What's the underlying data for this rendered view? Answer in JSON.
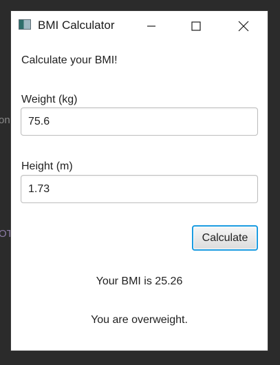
{
  "background": {
    "fragment_1": "on",
    "fragment_2": "OT"
  },
  "window": {
    "title": "BMI Calculator",
    "icon": "app-window-icon",
    "controls": {
      "minimize": "minimize-icon",
      "maximize": "maximize-icon",
      "close": "close-icon"
    }
  },
  "form": {
    "prompt": "Calculate your BMI!",
    "weight": {
      "label": "Weight (kg)",
      "value": "75.6"
    },
    "height": {
      "label": "Height (m)",
      "value": "1.73"
    },
    "calculate_label": "Calculate"
  },
  "result": {
    "bmi_text": "Your BMI is 25.26",
    "status_text": "You are overweight."
  },
  "colors": {
    "focus_border": "#1a9be0",
    "window_bg": "#ffffff",
    "desktop_bg": "#2b2b2b"
  }
}
